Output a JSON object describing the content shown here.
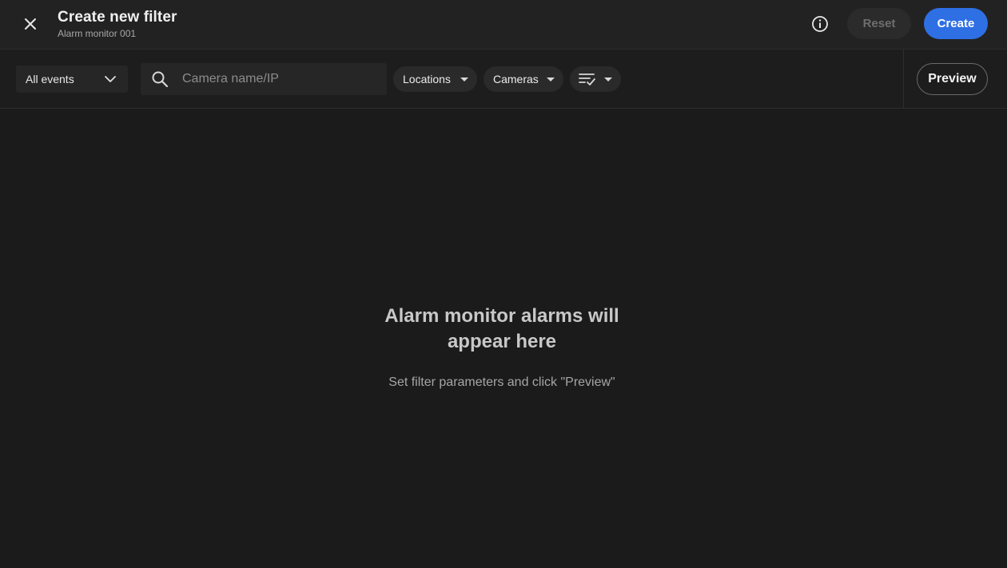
{
  "header": {
    "title": "Create new filter",
    "subtitle": "Alarm monitor 001",
    "reset_label": "Reset",
    "create_label": "Create"
  },
  "toolbar": {
    "events_select": {
      "selected": "All events"
    },
    "search": {
      "value": "",
      "placeholder": "Camera name/IP"
    },
    "chips": {
      "locations": "Locations",
      "cameras": "Cameras"
    },
    "preview_label": "Preview"
  },
  "empty_state": {
    "title": "Alarm monitor alarms will appear here",
    "hint": "Set filter parameters and click \"Preview\""
  },
  "colors": {
    "background": "#1b1b1b",
    "header_bg": "#222222",
    "accent": "#2f6fe4",
    "disabled_text": "#6e6e6e"
  },
  "icons": [
    "close-icon",
    "info-icon",
    "chevron-down-icon",
    "search-icon",
    "caret-down-icon",
    "filter-list-check-icon"
  ]
}
